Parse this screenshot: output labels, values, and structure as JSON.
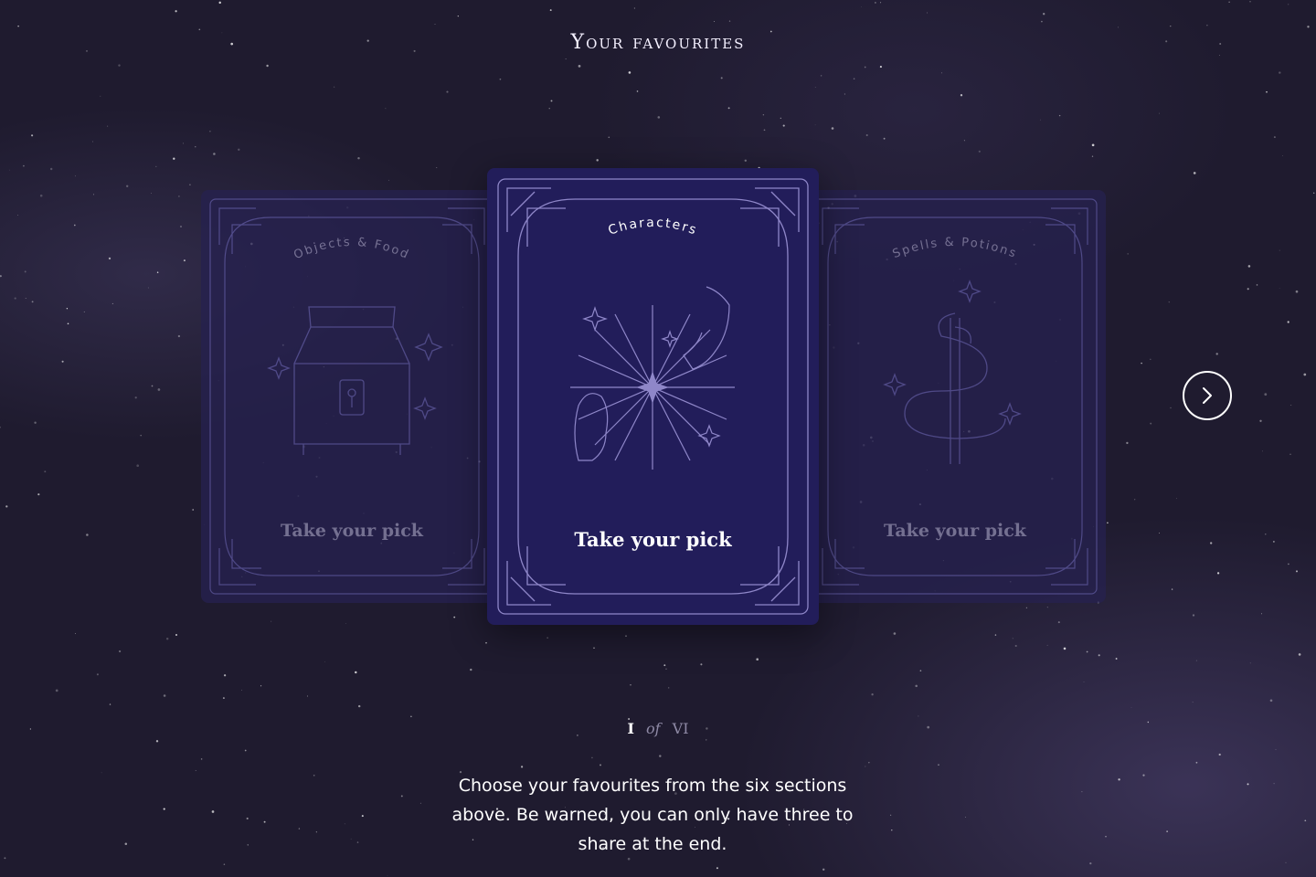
{
  "page": {
    "title": "Your favourites"
  },
  "cards": [
    {
      "category": "Objects & Food",
      "pick_label": "Take your pick",
      "icon": "treasure-chest-icon",
      "state": "inactive"
    },
    {
      "category": "Characters",
      "pick_label": "Take your pick",
      "icon": "hands-starburst-icon",
      "state": "active"
    },
    {
      "category": "Spells & Potions",
      "pick_label": "Take your pick",
      "icon": "serpent-staff-icon",
      "state": "inactive"
    }
  ],
  "navigation": {
    "next_icon": "chevron-right-icon"
  },
  "pager": {
    "current": "I",
    "separator": "of",
    "total": "VI"
  },
  "description": "Choose your favourites from the six sections above. Be warned, you can only have three to share at the end.",
  "colors": {
    "background": "#1f1b2f",
    "card_active": "#221d5a",
    "card_inactive": "#26214f",
    "line_art": "#8f87c9"
  }
}
